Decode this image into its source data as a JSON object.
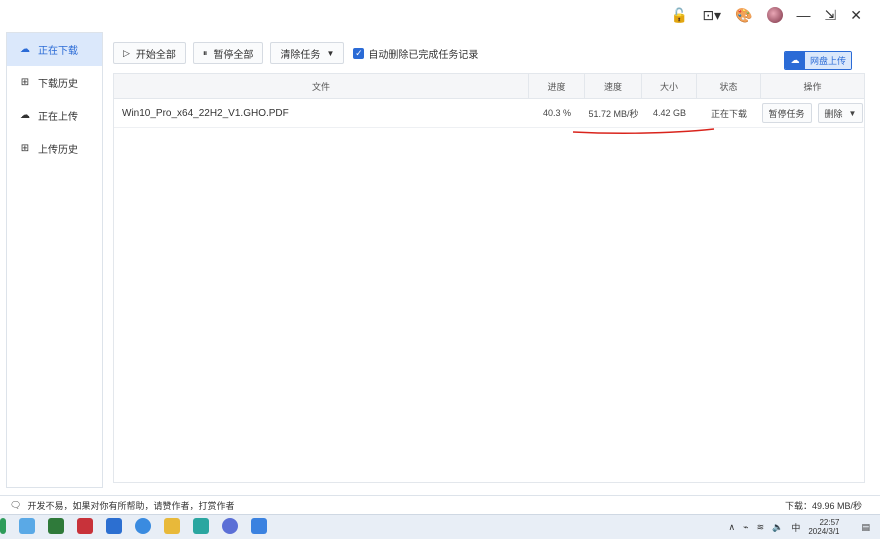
{
  "sidebar": {
    "items": [
      {
        "label": "正在下载",
        "icon": "cloud-download-icon",
        "active": true
      },
      {
        "label": "下载历史",
        "icon": "download-history-icon",
        "active": false
      },
      {
        "label": "正在上传",
        "icon": "cloud-upload-icon",
        "active": false
      },
      {
        "label": "上传历史",
        "icon": "upload-history-icon",
        "active": false
      }
    ]
  },
  "toolbar": {
    "start_all": "开始全部",
    "pause_all": "暂停全部",
    "clear_tasks": "清除任务",
    "auto_delete_label": "自动删除已完成任务记录",
    "auto_delete_checked": true
  },
  "switch": {
    "right_label": "网盘上传"
  },
  "table": {
    "headers": [
      "文件",
      "进度",
      "速度",
      "大小",
      "状态",
      "操作"
    ],
    "rows": [
      {
        "file": "Win10_Pro_x64_22H2_V1.GHO.PDF",
        "progress": "40.3 %",
        "speed": "51.72 MB/秒",
        "size": "4.42 GB",
        "state": "正在下载",
        "op_pause": "暂停任务",
        "op_delete": "删除"
      }
    ]
  },
  "status": {
    "left": "开发不易，如果对你有所帮助，请赞作者，打赏作者",
    "right": "下载：49.96 MB/秒"
  },
  "taskbar": {
    "ime": "中",
    "time": "22:57",
    "date": "2024/3/1"
  },
  "colors": {
    "accent": "#2b6bd6",
    "active_bg": "#dbe8fb",
    "annotation": "#d9241c"
  }
}
